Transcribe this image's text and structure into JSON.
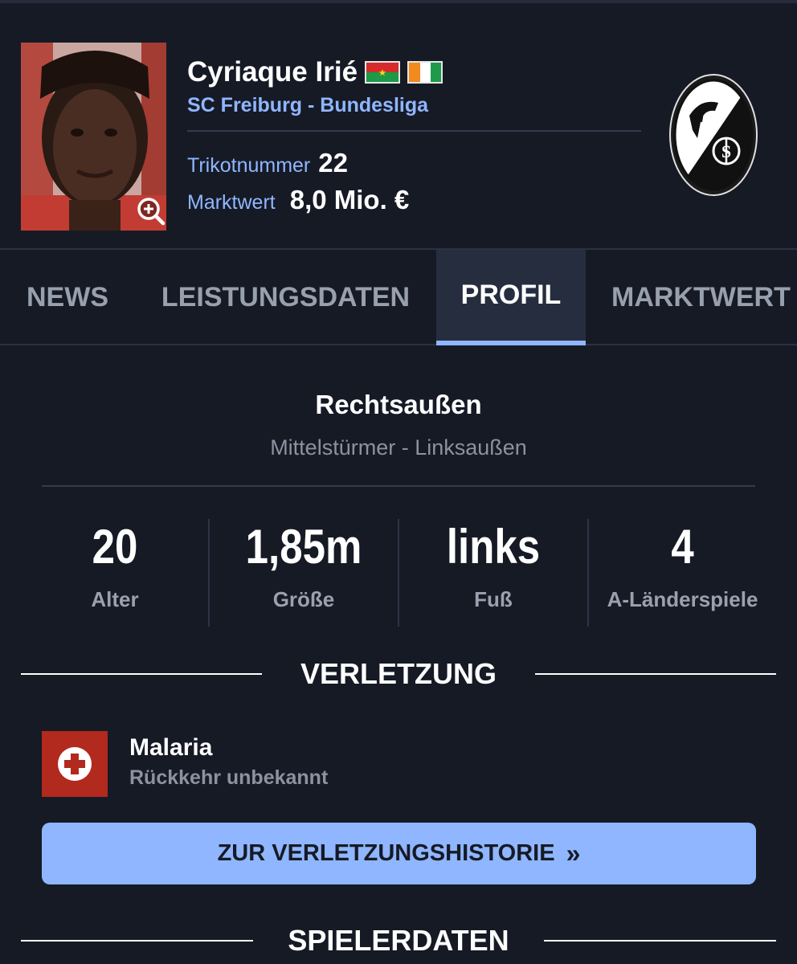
{
  "player": {
    "name": "Cyriaque Irié",
    "club_line": "SC Freiburg - Bundesliga",
    "jersey_label": "Trikotnummer",
    "jersey_number": "22",
    "value_label": "Marktwert",
    "market_value": "8,0 Mio. €",
    "flags": [
      "burkina-faso-flag",
      "ivory-coast-flag"
    ],
    "club_crest": "sc-freiburg-crest"
  },
  "tabs": [
    {
      "label": "NEWS",
      "active": false
    },
    {
      "label": "LEISTUNGSDATEN",
      "active": false
    },
    {
      "label": "PROFIL",
      "active": true
    },
    {
      "label": "MARKTWERT",
      "active": false
    }
  ],
  "position": {
    "main": "Rechtsaußen",
    "secondary": "Mittelstürmer - Linksaußen"
  },
  "stats": [
    {
      "value": "20",
      "label": "Alter"
    },
    {
      "value": "1,85m",
      "label": "Größe"
    },
    {
      "value": "links",
      "label": "Fuß"
    },
    {
      "value": "4",
      "label": "A-Länderspiele"
    }
  ],
  "injury": {
    "heading": "VERLETZUNG",
    "title": "Malaria",
    "status": "Rückkehr unbekannt",
    "icon": "medical-cross-icon",
    "button_label": "ZUR VERLETZUNGSHISTORIE",
    "button_icon": "»"
  },
  "player_data_heading": "SPIELERDATEN",
  "colors": {
    "background": "#161a25",
    "accent": "#8fb6ff",
    "injury_red": "#b2291e",
    "muted_text": "#8b92a0"
  }
}
